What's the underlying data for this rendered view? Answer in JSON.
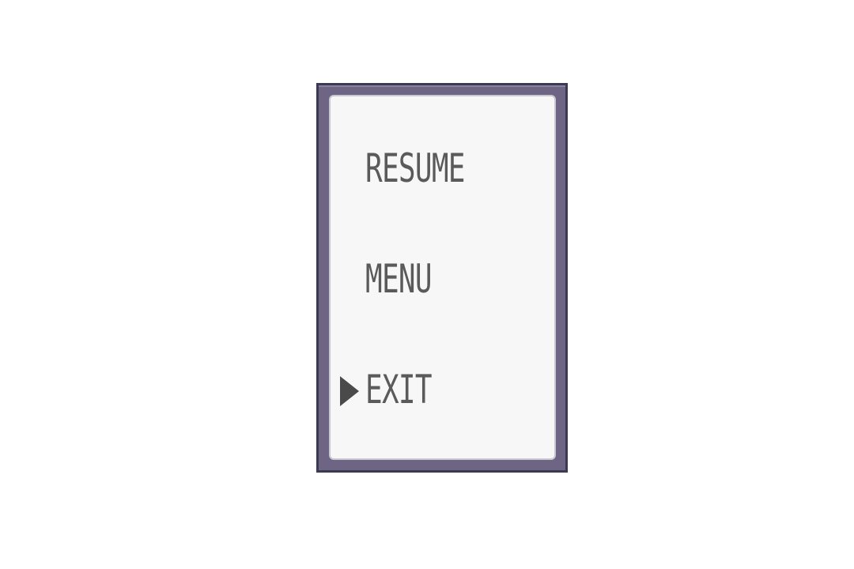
{
  "pause_menu": {
    "items": [
      {
        "label": "RESUME",
        "selected": false
      },
      {
        "label": "MENU",
        "selected": false
      },
      {
        "label": "EXIT",
        "selected": true
      }
    ],
    "cursor_icon": "triangle-right-icon",
    "colors": {
      "frame_outer": "#3c3a52",
      "frame": "#6e6585",
      "panel": "#f7f7f7",
      "text": "#5a5a5a",
      "cursor": "#4a4a4a"
    }
  }
}
